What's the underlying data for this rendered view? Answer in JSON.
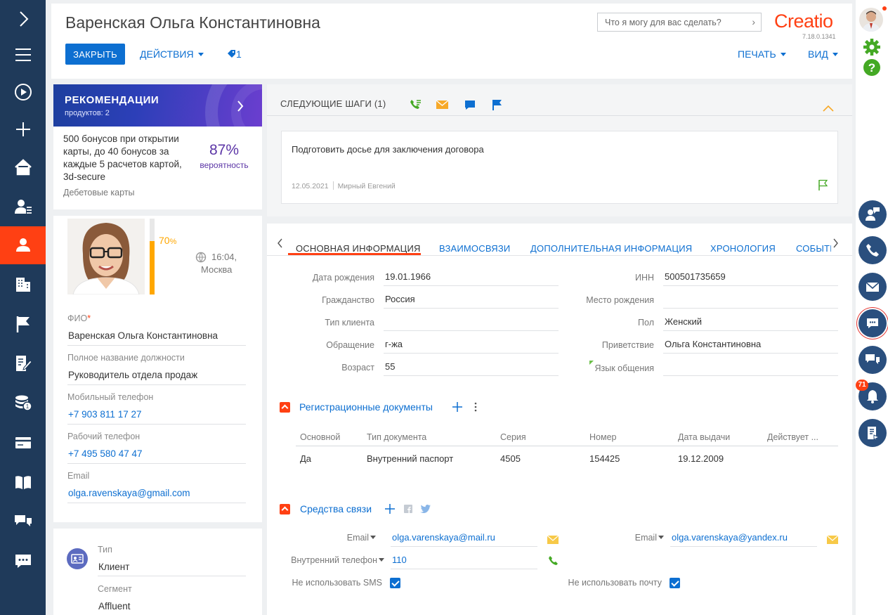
{
  "header": {
    "title": "Варенская Ольга Константиновна",
    "close_label": "ЗАКРЫТЬ",
    "actions_label": "ДЕЙСТВИЯ",
    "tags_count": "1",
    "print_label": "ПЕЧАТЬ",
    "view_label": "ВИД",
    "search_placeholder": "Что я могу для вас сделать?",
    "logo": "Creatio",
    "version": "7.18.0.1341"
  },
  "recommendations": {
    "title": "РЕКОМЕНДАЦИИ",
    "count": "продуктов: 2",
    "offer": "500 бонусов при открытии карты, до 40 бонусов за каждые 5 расчетов картой, 3d-secure",
    "percent": "87%",
    "percent_label": "вероятность",
    "category": "Дебетовые карты"
  },
  "profile": {
    "completeness": "70",
    "completeness_unit": "%",
    "time": "16:04,",
    "city": "Москва",
    "fio_label": "ФИО",
    "fio_required": "*",
    "fio": "Варенская Ольга Константиновна",
    "position_label": "Полное название должности",
    "position": "Руководитель отдела продаж",
    "mobile_label": "Мобильный телефон",
    "mobile": "+7 903 811 17 27",
    "work_phone_label": "Рабочий телефон",
    "work_phone": "+7 495 580 47 47",
    "email_label": "Email",
    "email": "olga.ravenskaya@gmail.com",
    "type_label": "Тип",
    "type": "Клиент",
    "segment_label": "Сегмент",
    "segment": "Affluent"
  },
  "next_steps": {
    "title": "СЛЕДУЮЩИЕ ШАГИ (1)",
    "task": "Подготовить досье для заключения договора",
    "date": "12.05.2021",
    "owner": "Мирный Евгений"
  },
  "tabs": [
    {
      "label": "ОСНОВНАЯ ИНФОРМАЦИЯ"
    },
    {
      "label": "ВЗАИМОСВЯЗИ"
    },
    {
      "label": "ДОПОЛНИТЕЛЬНАЯ ИНФОРМАЦИЯ"
    },
    {
      "label": "ХРОНОЛОГИЯ"
    },
    {
      "label": "СОБЫТИ"
    }
  ],
  "main_info": {
    "birth_label": "Дата рождения",
    "birth": "19.01.1966",
    "citizenship_label": "Гражданство",
    "citizenship": "Россия",
    "client_type_label": "Тип клиента",
    "client_type": "",
    "address_label": "Обращение",
    "address": "г-жа",
    "age_label": "Возраст",
    "age": "55",
    "inn_label": "ИНН",
    "inn": "500501735659",
    "birthplace_label": "Место рождения",
    "birthplace": "",
    "gender_label": "Пол",
    "gender": "Женский",
    "greeting_label": "Приветствие",
    "greeting": "Ольга Константиновна",
    "language_label": "Язык общения",
    "language": ""
  },
  "documents": {
    "title": "Регистрационные документы",
    "columns": [
      "Основной",
      "Тип документа",
      "Серия",
      "Номер",
      "Дата выдачи",
      "Действует ..."
    ],
    "rows": [
      [
        "Да",
        "Внутренний паспорт",
        "4505",
        "154425",
        "19.12.2009",
        ""
      ]
    ]
  },
  "communications": {
    "title": "Средства связи",
    "email1_label": "Email",
    "email1": "olga.varenskaya@mail.ru",
    "email2_label": "Email",
    "email2": "olga.varenskaya@yandex.ru",
    "internal_label": "Внутренний телефон",
    "internal": "110",
    "no_sms_label": "Не использовать SMS",
    "no_mail_label": "Не использовать почту"
  },
  "notifications_count": "71",
  "colors": {
    "accent": "#0d6fd1",
    "brand": "#ff4013",
    "sidebar": "#1f3a5a"
  }
}
